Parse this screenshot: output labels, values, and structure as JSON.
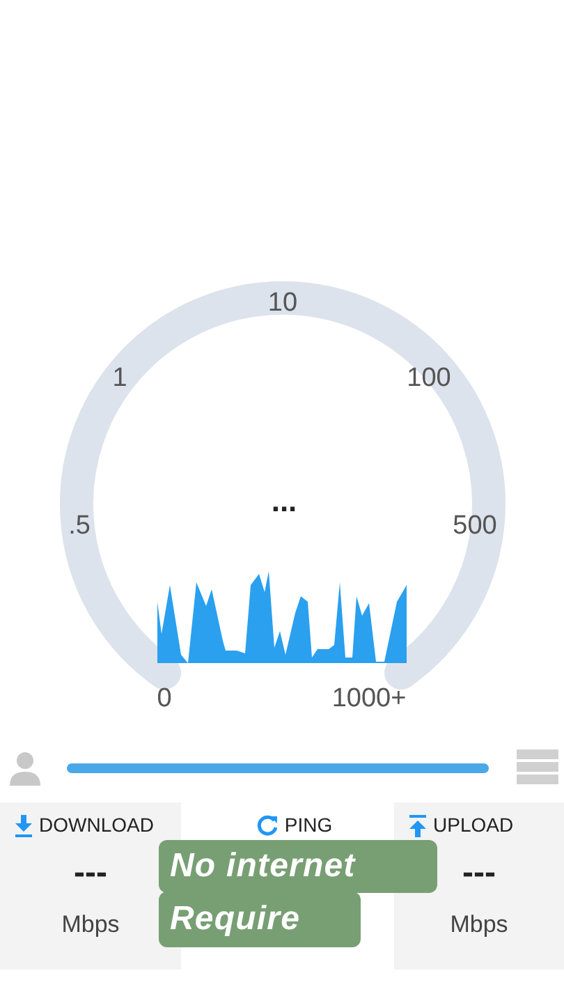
{
  "gauge": {
    "ticks": [
      "10",
      "1",
      "100",
      ".5",
      "500",
      "0",
      "1000+"
    ],
    "reading": "..."
  },
  "stats": [
    {
      "kind": "download",
      "label": "DOWNLOAD",
      "value": "---",
      "unit": "Mbps"
    },
    {
      "kind": "ping",
      "label": "PING"
    },
    {
      "kind": "upload",
      "label": "UPLOAD",
      "value": "---",
      "unit": "Mbps"
    }
  ],
  "caption": [
    "No internet",
    "Require"
  ]
}
